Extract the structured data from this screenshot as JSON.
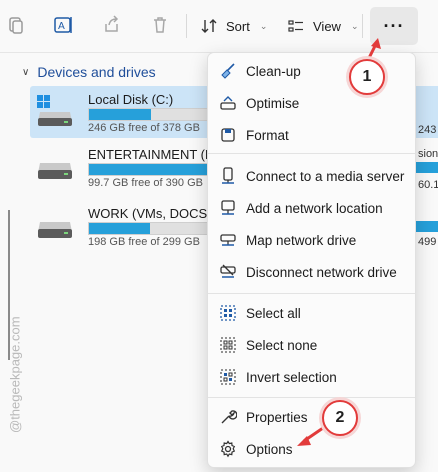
{
  "toolbar": {
    "sort_label": "Sort",
    "view_label": "View",
    "more_label": "···"
  },
  "sidebar": {
    "section_title": "Devices and drives",
    "watermark": "@thegeekpage.com"
  },
  "drives": [
    {
      "name": "Local Disk (C:)",
      "free_text": "246 GB free of 378 GB",
      "used_fraction": 0.35,
      "side_text": "243"
    },
    {
      "name": "ENTERTAINMENT (F:)",
      "free_text": "99.7 GB free of 390 GB",
      "used_fraction": 0.74,
      "side_text_top": "sion",
      "side_text": "60.1"
    },
    {
      "name": "WORK (VMs, DOCS) (I:)",
      "free_text": "198 GB free of 299 GB",
      "used_fraction": 0.34,
      "side_text": "499"
    }
  ],
  "menu": {
    "items": [
      {
        "label": "Clean-up",
        "icon": "broom-icon"
      },
      {
        "label": "Optimise",
        "icon": "optimise-icon"
      },
      {
        "label": "Format",
        "icon": "format-icon"
      },
      {
        "label": "Connect to a media server",
        "icon": "media-server-icon"
      },
      {
        "label": "Add a network location",
        "icon": "network-location-icon"
      },
      {
        "label": "Map network drive",
        "icon": "map-drive-icon"
      },
      {
        "label": "Disconnect network drive",
        "icon": "disconnect-drive-icon"
      },
      {
        "label": "Select all",
        "icon": "select-all-icon"
      },
      {
        "label": "Select none",
        "icon": "select-none-icon"
      },
      {
        "label": "Invert selection",
        "icon": "invert-selection-icon"
      },
      {
        "label": "Properties",
        "icon": "wrench-icon"
      },
      {
        "label": "Options",
        "icon": "gear-icon"
      }
    ]
  },
  "callouts": [
    "1",
    "2"
  ],
  "colors": {
    "accent": "#26a0da",
    "selection": "#cce4f7",
    "callout": "#e23b3b"
  }
}
